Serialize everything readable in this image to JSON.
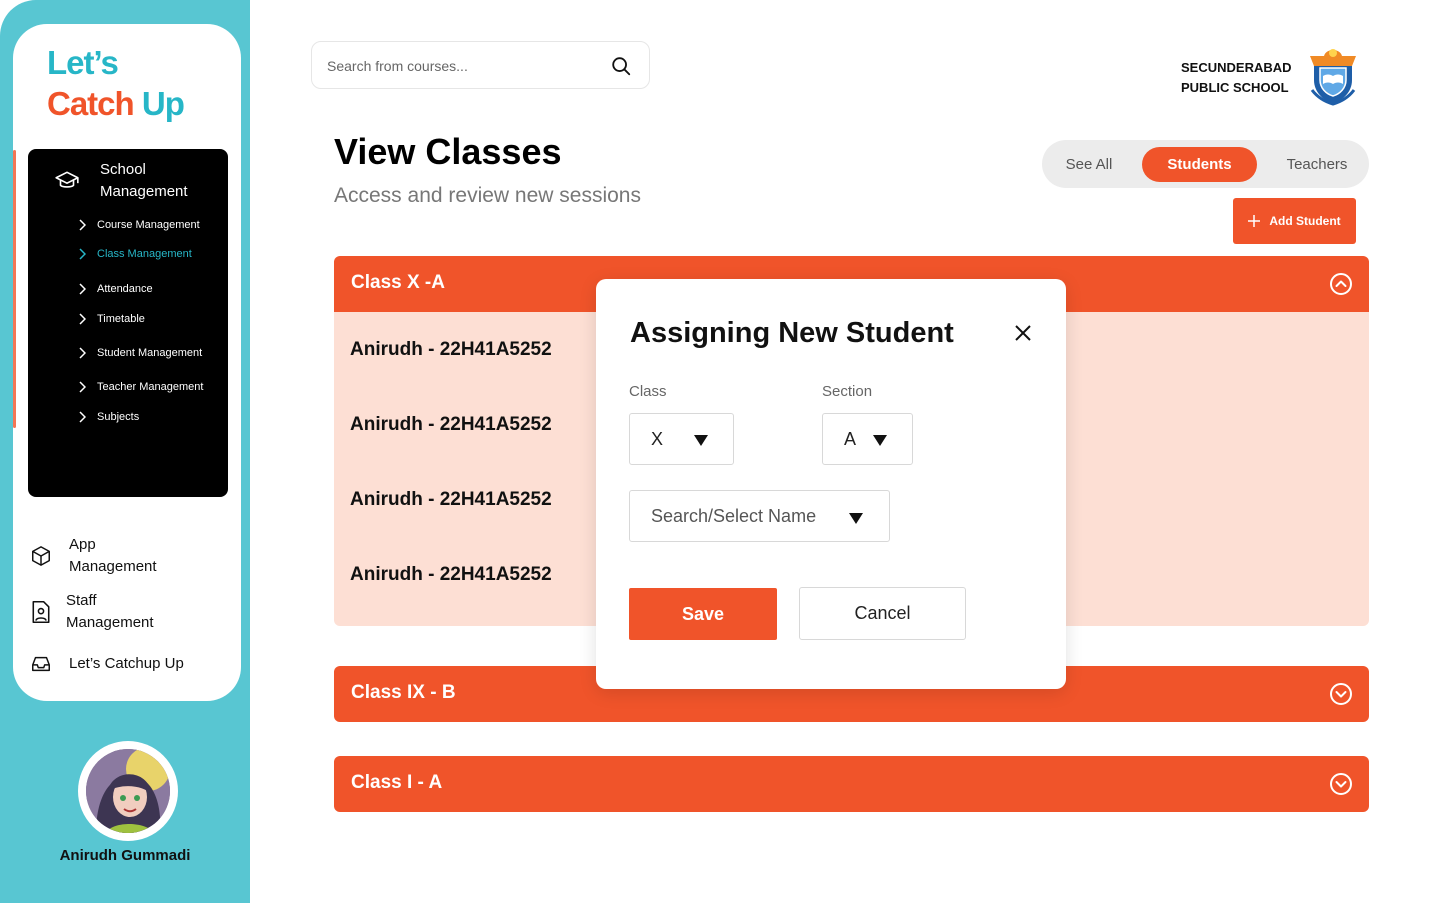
{
  "app": {
    "logo_line1": "Let’s",
    "logo_line2_a": "Catch ",
    "logo_line2_b": "Up",
    "brand_colors": {
      "teal": "#58c6d2",
      "orange": "#f0542a",
      "light_orange": "#fddfd4"
    }
  },
  "sidebar": {
    "section_title": "School Management",
    "section_icon": "graduation-cap-icon",
    "sub_items": [
      {
        "label": "Course Management",
        "active": false
      },
      {
        "label": "Class Management",
        "active": true
      },
      {
        "label": "Attendance",
        "active": false
      },
      {
        "label": "Timetable",
        "active": false
      },
      {
        "label": "Student Management",
        "active": false
      },
      {
        "label": "Teacher Management",
        "active": false
      },
      {
        "label": "Subjects",
        "active": false
      }
    ],
    "links": [
      {
        "label": "App Management",
        "icon": "cube-icon"
      },
      {
        "label": "Staff Management",
        "icon": "id-badge-icon"
      },
      {
        "label": "Let’s Catchup Up",
        "icon": "inbox-icon"
      }
    ],
    "user_name": "Anirudh Gummadi"
  },
  "header": {
    "search_placeholder": "Search from courses...",
    "school_line1": "SECUNDERABAD",
    "school_line2": "PUBLIC SCHOOL"
  },
  "page": {
    "title": "View Classes",
    "subtitle": "Access and review new sessions",
    "filters": [
      "See All",
      "Students",
      "Teachers"
    ],
    "active_filter": "Students",
    "add_button": "Add Student"
  },
  "classes": [
    {
      "name": "Class X -A",
      "expanded": true,
      "students": [
        "Anirudh - 22H41A5252",
        "Anirudh - 22H41A5252",
        "Anirudh - 22H41A5252",
        "Anirudh - 22H41A5252"
      ]
    },
    {
      "name": "Class IX - B",
      "expanded": false
    },
    {
      "name": "Class I - A",
      "expanded": false
    }
  ],
  "modal": {
    "title": "Assigning New Student",
    "class_label": "Class",
    "class_value": "X",
    "section_label": "Section",
    "section_value": "A",
    "name_placeholder": "Search/Select Name",
    "save_label": "Save",
    "cancel_label": "Cancel"
  }
}
